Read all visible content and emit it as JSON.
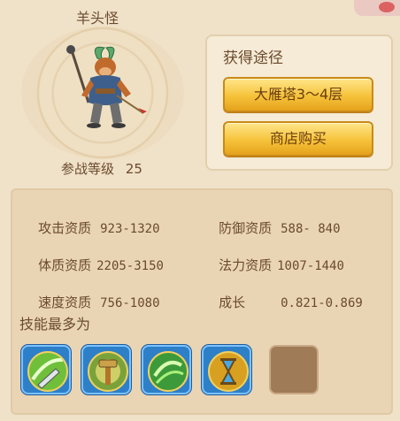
{
  "pet": {
    "name": "羊头怪",
    "battle_level_label": "参战等级",
    "battle_level": "25"
  },
  "obtain": {
    "title": "获得途径",
    "buttons": [
      "大雁塔3～4层",
      "商店购买"
    ]
  },
  "stats": [
    {
      "label": "攻击资质",
      "value": "923-1320"
    },
    {
      "label": "防御资质",
      "value": "588- 840"
    },
    {
      "label": "体质资质",
      "value": "2205-3150"
    },
    {
      "label": "法力资质",
      "value": "1007-1440"
    },
    {
      "label": "速度资质",
      "value": "756-1080"
    },
    {
      "label": "成长",
      "value": "0.821-0.869"
    }
  ],
  "skills": {
    "title": "技能最多为",
    "icons": [
      "sword-wind-skill-icon",
      "hammer-skill-icon",
      "green-wind-skill-icon",
      "hourglass-skill-icon"
    ],
    "empty_slots": 1
  },
  "colors": {
    "panel": "#f0e2c8",
    "button_gold": "#f6c23a",
    "skill_frame": "#2d7fc8"
  }
}
